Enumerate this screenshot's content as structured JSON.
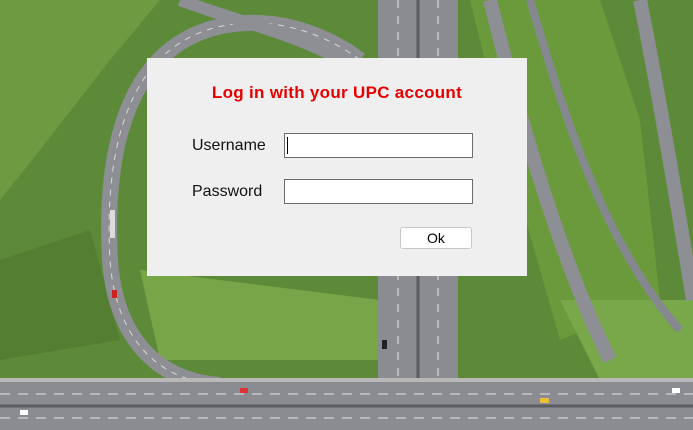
{
  "login": {
    "title": "Log in with your UPC account",
    "title_color": "#e60000",
    "username_label": "Username",
    "username_value": "",
    "password_label": "Password",
    "password_value": "",
    "ok_label": "Ok"
  },
  "background": {
    "description_icon": "highway-interchange-aerial-photo",
    "grass_color": "#5f8a3a",
    "road_color": "#8e9096"
  }
}
